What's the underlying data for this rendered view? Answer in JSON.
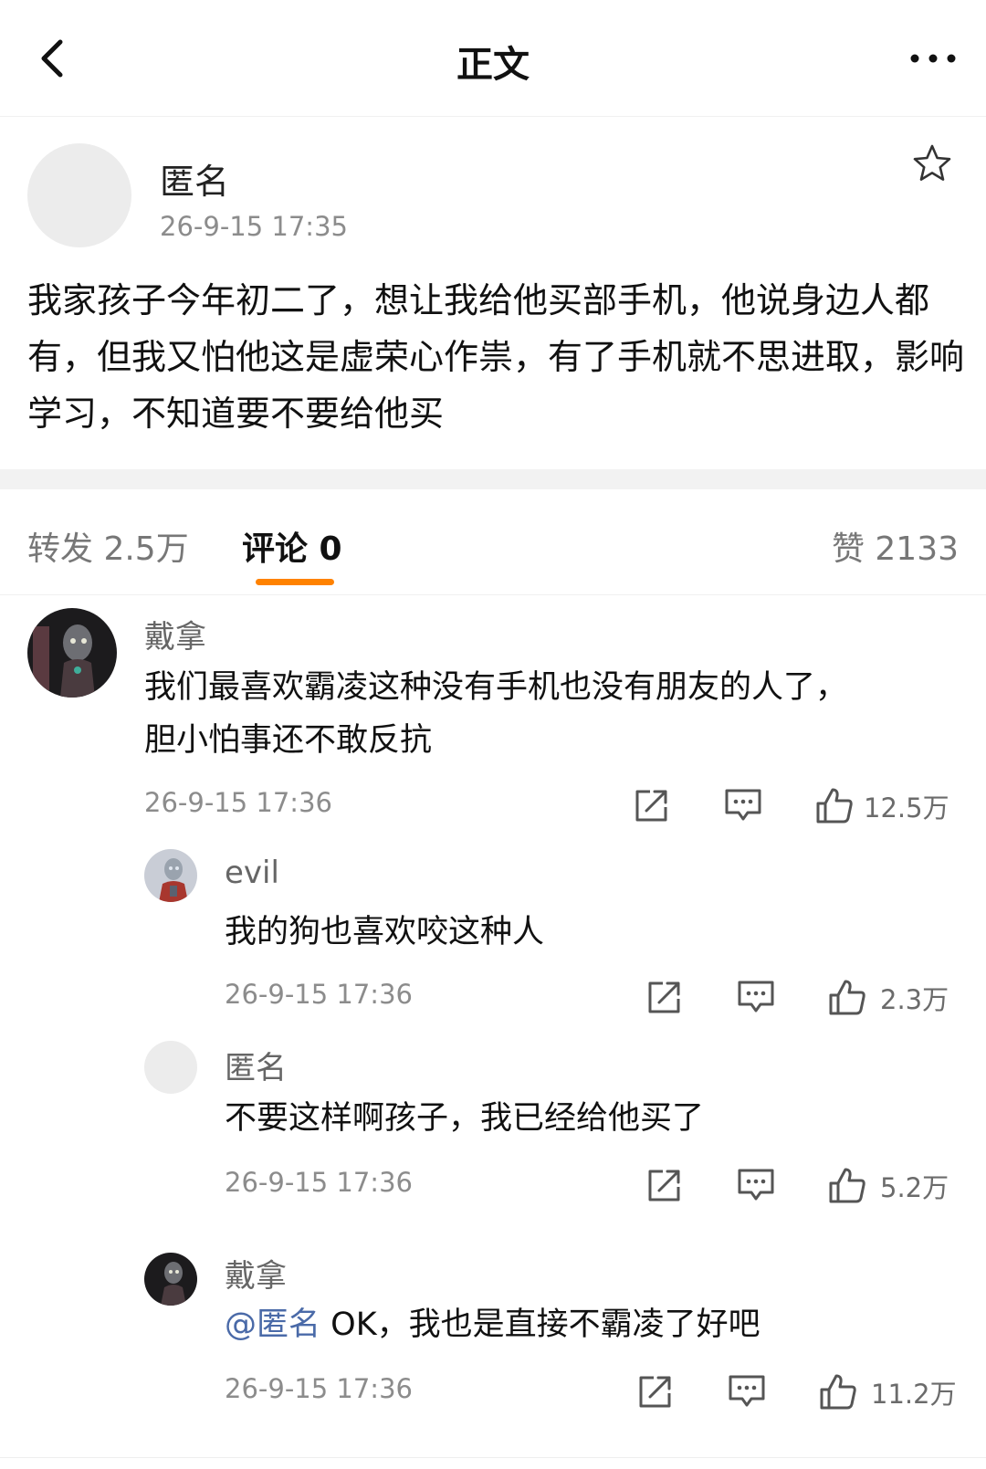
{
  "header": {
    "title": "正文",
    "back_icon": "chevron-left-icon",
    "more_icon": "more-dots-icon"
  },
  "post": {
    "author": "匿名",
    "time": "26-9-15 17:35",
    "text": "我家孩子今年初二了，想让我给他买部手机，他说身边人都有，但我又怕他这是虚荣心作祟，有了手机就不思进取，影响学习，不知道要不要给他买",
    "favorite_icon": "star-icon"
  },
  "tabs": {
    "repost": "转发 2.5万",
    "comments": "评论 0",
    "likes": "赞 2133",
    "accent_color": "#ff8200"
  },
  "comments": [
    {
      "name": "戴拿",
      "text": "我们最喜欢霸凌这种没有手机也没有朋友的人了，胆小怕事还不敢反抗",
      "time": "26-9-15 17:36",
      "likes": "12.5万"
    },
    {
      "name": "evil",
      "text": "我的狗也喜欢咬这种人",
      "time": "26-9-15 17:36",
      "likes": "2.3万"
    },
    {
      "name": "匿名",
      "text": "不要这样啊孩子，我已经给他买了",
      "time": "26-9-15 17:36",
      "likes": "5.2万"
    },
    {
      "name": "戴拿",
      "mention": "@匿名",
      "text": " OK，我也是直接不霸凌了好吧",
      "time": "26-9-15 17:36",
      "likes": "11.2万"
    }
  ]
}
